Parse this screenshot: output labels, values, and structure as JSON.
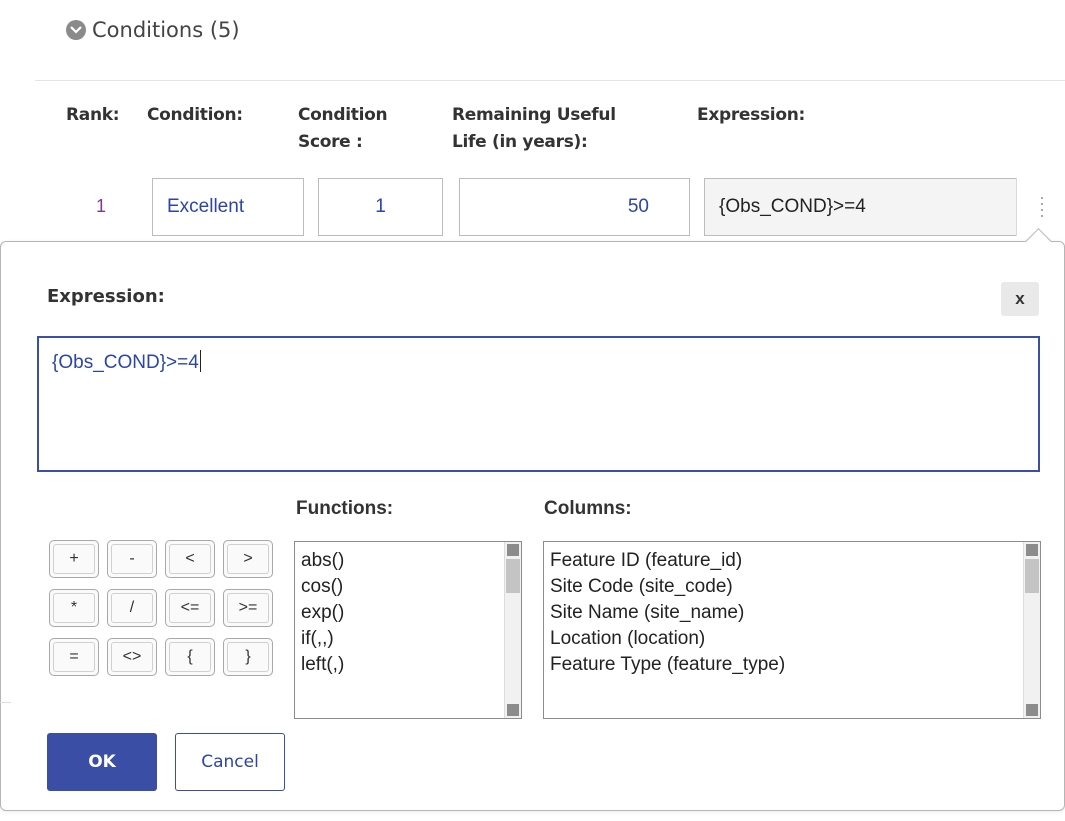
{
  "section": {
    "title": "Conditions (5)"
  },
  "table": {
    "headers": {
      "rank": "Rank:",
      "condition": "Condition:",
      "score": "Condition\nScore :",
      "life": "Remaining Useful\nLife (in years):",
      "expression": "Expression:"
    },
    "row": {
      "rank": "1",
      "condition": "Excellent",
      "score": "1",
      "life": "50",
      "expression": "{Obs_COND}>=4"
    }
  },
  "popup": {
    "title": "Expression:",
    "close_label": "x",
    "expression_value": "{Obs_COND}>=4",
    "operators": [
      "+",
      "-",
      "<",
      ">",
      "*",
      "/",
      "<=",
      ">=",
      "=",
      "<>",
      "{",
      "}"
    ],
    "functions_label": "Functions:",
    "functions": [
      "abs()",
      "cos()",
      "exp()",
      "if(,,)",
      "left(,)"
    ],
    "columns_label": "Columns:",
    "columns": [
      "Feature ID (feature_id)",
      "Site Code (site_code)",
      "Site Name (site_name)",
      "Location (location)",
      "Feature Type (feature_type)"
    ],
    "ok_label": "OK",
    "cancel_label": "Cancel"
  },
  "colors": {
    "accent": "#3a4ea6",
    "link_text": "#2c45a8",
    "rank_text": "#7a3a8e"
  }
}
